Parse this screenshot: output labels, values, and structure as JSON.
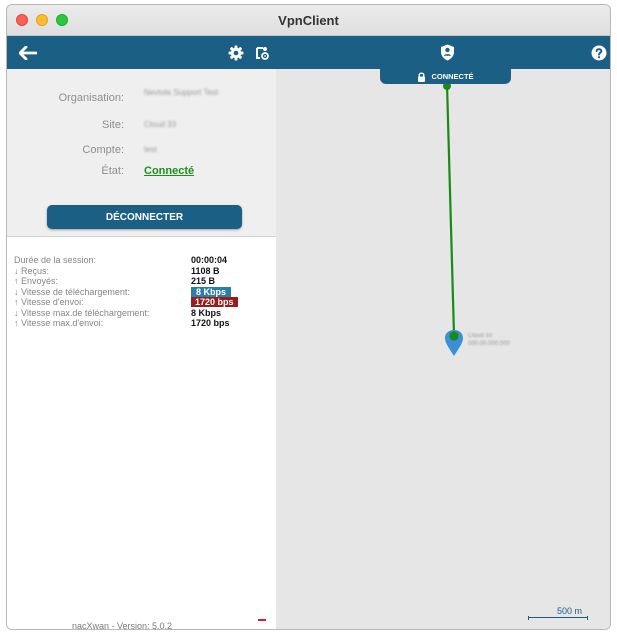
{
  "window": {
    "title": "VpnClient"
  },
  "toolbar": {
    "back_icon": "arrow-left-icon",
    "settings_icon": "gear-icon",
    "secondary_icon": "device-settings-icon",
    "shield_icon": "shield-user-icon",
    "help_icon": "help-icon"
  },
  "connection": {
    "status_label": "CONNECTÉ",
    "fields": [
      {
        "label": "Organisation:",
        "value": "Nevtola Support Test"
      },
      {
        "label": "Site:",
        "value": "Cloud 33"
      },
      {
        "label": "Compte:",
        "value": "test"
      }
    ],
    "state_label": "État:",
    "state_value": "Connecté",
    "disconnect_label": "DÉCONNECTER"
  },
  "stats": [
    {
      "label": "Durée de la session:",
      "value": "00:00:04"
    },
    {
      "label": "↓ Reçus:",
      "value": "1108 B"
    },
    {
      "label": "↑ Envoyés:",
      "value": "215 B"
    },
    {
      "label": "↓ Vitesse de téléchargement:",
      "value": "8 Kbps",
      "badge": "#2a7fa8"
    },
    {
      "label": "↑ Vitesse d'envoi:",
      "value": "1720 bps",
      "badge": "#9b1c1c"
    },
    {
      "label": "↓ Vitesse max.de téléchargement:",
      "value": "8 Kbps"
    },
    {
      "label": "↑ Vitesse max.d'envoi:",
      "value": "1720 bps"
    }
  ],
  "footer": {
    "version": "nacXwan - Version: 5.0.2"
  },
  "map": {
    "location_label_line1": "Cloud 33",
    "location_label_line2": "000.00.000.000",
    "scale_label": "500 m"
  },
  "colors": {
    "accent": "#1c5f84",
    "connected": "#1a8f1a",
    "route": "#178a17",
    "pin": "#3a8fd6"
  }
}
